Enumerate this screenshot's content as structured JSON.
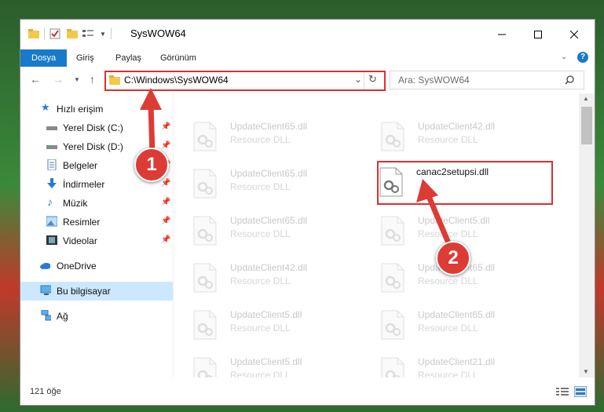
{
  "window": {
    "title": "SysWOW64"
  },
  "ribbon": {
    "tabs": [
      "Dosya",
      "Giriş",
      "Paylaş",
      "Görünüm"
    ]
  },
  "address": {
    "path": "C:\\Windows\\SysWOW64"
  },
  "search": {
    "placeholder": "Ara: SysWOW64"
  },
  "sidebar": {
    "items": [
      {
        "label": "Hızlı erişim",
        "icon": "star-icon",
        "pinned": false
      },
      {
        "label": "Yerel Disk (C:)",
        "icon": "drive-icon",
        "pinned": true
      },
      {
        "label": "Yerel Disk (D:)",
        "icon": "drive-icon",
        "pinned": true
      },
      {
        "label": "Belgeler",
        "icon": "documents-icon",
        "pinned": true
      },
      {
        "label": "İndirmeler",
        "icon": "download-icon",
        "pinned": true
      },
      {
        "label": "Müzik",
        "icon": "music-icon",
        "pinned": true
      },
      {
        "label": "Resimler",
        "icon": "pictures-icon",
        "pinned": true
      },
      {
        "label": "Videolar",
        "icon": "videos-icon",
        "pinned": true
      },
      {
        "label": "OneDrive",
        "icon": "cloud-icon",
        "pinned": false
      },
      {
        "label": "Bu bilgisayar",
        "icon": "computer-icon",
        "pinned": false,
        "selected": true
      },
      {
        "label": "Ağ",
        "icon": "network-icon",
        "pinned": false
      }
    ]
  },
  "files": [
    {
      "name": "UpdateClient65.dll",
      "type": "Resource DLL"
    },
    {
      "name": "UpdateClient42.dll",
      "type": "Resource DLL"
    },
    {
      "name": "UpdateClient65.dll",
      "type": "Resource DLL"
    },
    {
      "name": "canac2setupsi.dll",
      "type": "",
      "highlight": true
    },
    {
      "name": "UpdateClient65.dll",
      "type": "Resource DLL"
    },
    {
      "name": "UpdateClient5.dll",
      "type": "Resource DLL"
    },
    {
      "name": "UpdateClient42.dll",
      "type": "Resource DLL"
    },
    {
      "name": "UpdateClient65.dll",
      "type": "Resource DLL"
    },
    {
      "name": "UpdateClient5.dll",
      "type": "Resource DLL"
    },
    {
      "name": "UpdateClient65.dll",
      "type": "Resource DLL"
    },
    {
      "name": "UpdateClient5.dll",
      "type": "Resource DLL"
    },
    {
      "name": "UpdateClient21.dll",
      "type": "Resource DLL"
    }
  ],
  "status": {
    "count_text": "121 öğe"
  },
  "callouts": [
    "1",
    "2"
  ],
  "colors": {
    "accent": "#1979ca",
    "callout": "#dd3b36",
    "selected": "#cce8ff"
  }
}
